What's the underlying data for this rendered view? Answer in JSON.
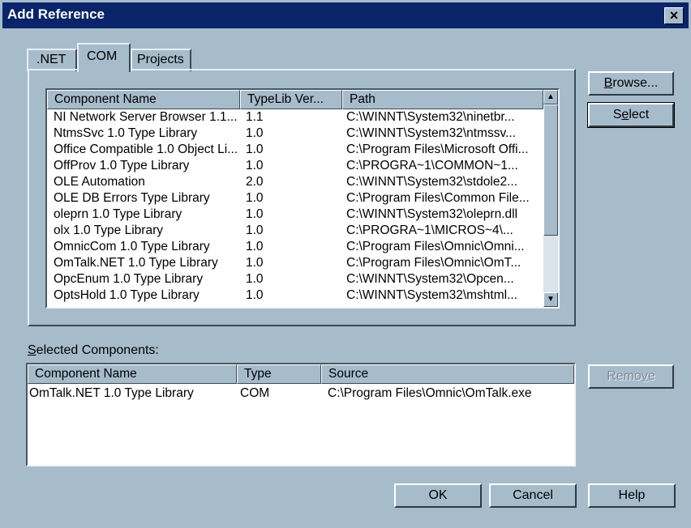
{
  "window": {
    "title": "Add Reference",
    "close_glyph": "×"
  },
  "tabs": [
    {
      "label": ".NET",
      "active": false
    },
    {
      "label": "COM",
      "active": true
    },
    {
      "label": "Projects",
      "active": false
    }
  ],
  "components": {
    "columns": [
      "Component Name",
      "TypeLib Ver...",
      "Path"
    ],
    "rows": [
      [
        "NI Network Server Browser 1.1...",
        "1.1",
        "C:\\WINNT\\System32\\ninetbr..."
      ],
      [
        "NtmsSvc 1.0 Type Library",
        "1.0",
        "C:\\WINNT\\System32\\ntmssv..."
      ],
      [
        "Office Compatible 1.0 Object Li...",
        "1.0",
        "C:\\Program Files\\Microsoft Offi..."
      ],
      [
        "OffProv 1.0 Type Library",
        "1.0",
        "C:\\PROGRA~1\\COMMON~1..."
      ],
      [
        "OLE Automation",
        "2.0",
        "C:\\WINNT\\System32\\stdole2..."
      ],
      [
        "OLE DB Errors Type Library",
        "1.0",
        "C:\\Program Files\\Common File..."
      ],
      [
        "oleprn 1.0 Type Library",
        "1.0",
        "C:\\WINNT\\System32\\oleprn.dll"
      ],
      [
        "olx 1.0 Type Library",
        "1.0",
        "C:\\PROGRA~1\\MICROS~4\\..."
      ],
      [
        "OmnicCom 1.0 Type Library",
        "1.0",
        "C:\\Program Files\\Omnic\\Omni..."
      ],
      [
        "OmTalk.NET 1.0 Type Library",
        "1.0",
        "C:\\Program Files\\Omnic\\OmT..."
      ],
      [
        "OpcEnum 1.0 Type Library",
        "1.0",
        "C:\\WINNT\\System32\\Opcen..."
      ],
      [
        "OptsHold 1.0 Type Library",
        "1.0",
        "C:\\WINNT\\System32\\mshtml..."
      ]
    ]
  },
  "selected": {
    "label_accel": "S",
    "label_rest": "elected Components:",
    "columns": [
      "Component Name",
      "Type",
      "Source"
    ],
    "rows": [
      [
        "OmTalk.NET 1.0 Type Library",
        "COM",
        "C:\\Program Files\\Omnic\\OmTalk.exe"
      ]
    ]
  },
  "buttons": {
    "browse": {
      "accel": "B",
      "rest": "rowse..."
    },
    "select": {
      "pre": "S",
      "accel": "e",
      "rest": "lect"
    },
    "remove": {
      "pre": "Remo",
      "accel": "v",
      "rest": "e"
    },
    "ok": "OK",
    "cancel": "Cancel",
    "help": "Help"
  },
  "scrollbar": {
    "up_icon": "▲",
    "down_icon": "▼"
  },
  "colors": {
    "face": "#a7bccb",
    "titlebar": "#0a246a"
  }
}
